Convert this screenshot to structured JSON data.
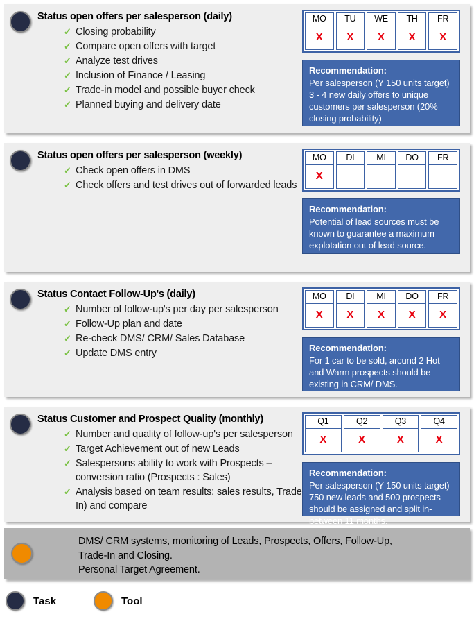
{
  "legend": {
    "items": [
      {
        "label": "Task",
        "color": "#252c45",
        "icon": "task-circle-icon"
      },
      {
        "label": "Tool",
        "color": "#f08a00",
        "icon": "tool-circle-icon"
      }
    ]
  },
  "tool_bar": {
    "icon": "tool-circle-icon",
    "color": "#f08a00",
    "text": "DMS/ CRM systems, monitoring of Leads, Prospects, Offers, Follow-Up,\nTrade-In and Closing.\nPersonal Target Agreement."
  },
  "colors": {
    "task_circle": "#252c45",
    "tool_circle": "#f08a00",
    "panel_background": "#eeeeee",
    "tool_background": "#b3b3b3",
    "table_border": "#3d62a5",
    "recommendation_background": "#4268ab",
    "check_mark": "#7ac143",
    "x_mark": "#e8000d"
  },
  "sections": [
    {
      "id": "status-open-offers-daily",
      "title": "Status open offers per salesperson (daily)",
      "bullets": [
        "Closing probability",
        "Compare open offers with target",
        "Analyze test drives",
        "Inclusion of Finance / Leasing",
        "Trade-in model and possible buyer check",
        "Planned buying and delivery date"
      ],
      "table": {
        "headers": [
          "MO",
          "TU",
          "WE",
          "TH",
          "FR"
        ],
        "marks": [
          "X",
          "X",
          "X",
          "X",
          "X"
        ]
      },
      "recommendation": {
        "title": "Recommendation:",
        "text": "Per salesperson (Y 150 units target) 3 - 4 new daily offers to unique customers per salesperson (20% closing probability)"
      }
    },
    {
      "id": "status-open-offers-weekly",
      "title": "Status open offers per salesperson (weekly)",
      "bullets": [
        "Check open offers in DMS",
        "Check offers and test drives out of forwarded leads"
      ],
      "table": {
        "headers": [
          "MO",
          "DI",
          "MI",
          "DO",
          "FR"
        ],
        "marks": [
          "X",
          "",
          "",
          "",
          ""
        ]
      },
      "recommendation": {
        "title": "Recommendation:",
        "text": "Potential of lead sources must be known to guarantee a maximum explotation out of lead source."
      }
    },
    {
      "id": "status-contact-follow-ups-daily",
      "title": "Status Contact Follow-Up's (daily)",
      "bullets": [
        "Number of follow-up's per day per salesperson",
        "Follow-Up plan and date",
        "Re-check DMS/ CRM/ Sales Database",
        "Update DMS entry"
      ],
      "table": {
        "headers": [
          "MO",
          "DI",
          "MI",
          "DO",
          "FR"
        ],
        "marks": [
          "X",
          "X",
          "X",
          "X",
          "X"
        ]
      },
      "recommendation": {
        "title": "Recommendation:",
        "text": "For 1 car to be sold, arcund 2 Hot and Warm prospects should be existing in CRM/ DMS."
      }
    },
    {
      "id": "status-customer-prospect-quality-monthly",
      "title": "Status Customer and Prospect Quality (monthly)",
      "bullets": [
        "Number and quality of follow-up's per salesperson",
        "Target Achievement out of new Leads",
        "Salespersons ability to work with Prospects – conversion ratio (Prospects : Sales)",
        "Analysis based on team results: sales results, Trade-In) and compare"
      ],
      "table": {
        "headers": [
          "Q1",
          "Q2",
          "Q3",
          "Q4"
        ],
        "marks": [
          "X",
          "X",
          "X",
          "X"
        ]
      },
      "recommendation": {
        "title": "Recommendation:",
        "text": "Per salesperson (Y 150 units target) 750 new leads and 500 prospects should be assigned and split in-between 11 months."
      }
    }
  ]
}
